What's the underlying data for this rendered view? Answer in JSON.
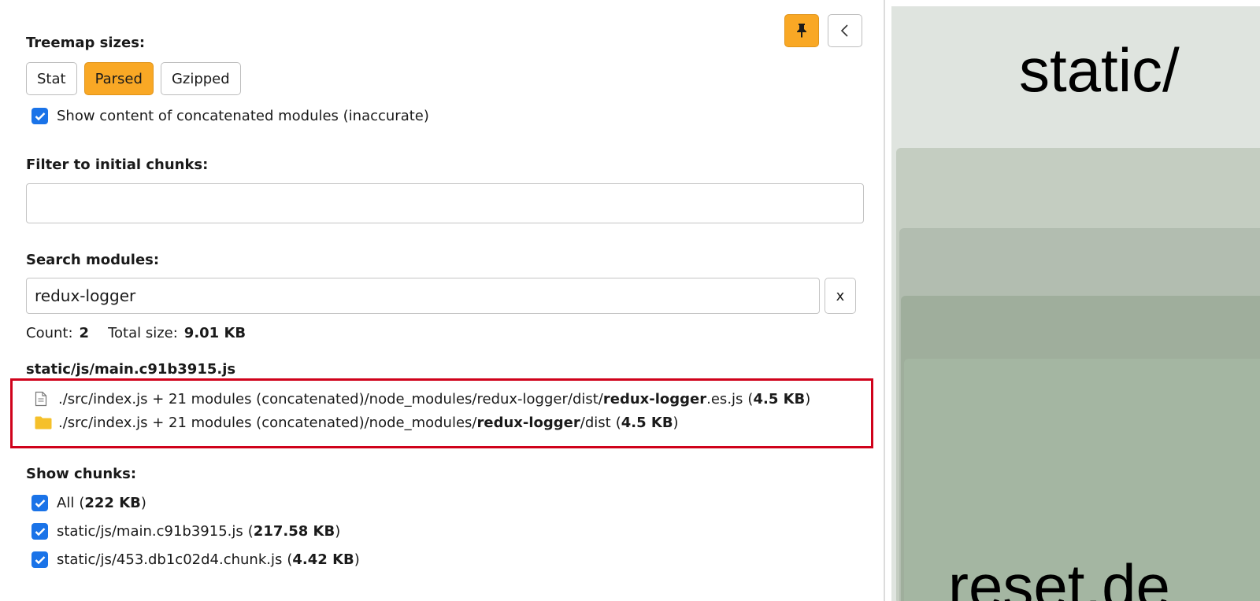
{
  "sidebar": {
    "treemap_sizes_label": "Treemap sizes:",
    "size_buttons": [
      "Stat",
      "Parsed",
      "Gzipped"
    ],
    "active_size": "Parsed",
    "concat_checkbox_label": "Show content of concatenated modules (inaccurate)",
    "filter_label": "Filter to initial chunks:",
    "filter_value": "",
    "search_label": "Search modules:",
    "search_value": "redux-logger",
    "clear_label": "x",
    "count_label": "Count:",
    "count_value": "2",
    "total_size_label": "Total size:",
    "total_size_value": "9.01 KB",
    "chunk_title": "static/js/main.c91b3915.js",
    "results": [
      {
        "icon": "file-icon",
        "prefix": "./src/index.js + 21 modules (concatenated)/node_modules/redux-logger/dist/",
        "match": "redux-logger",
        "suffix": ".es.js",
        "size": "4.5 KB"
      },
      {
        "icon": "folder-icon",
        "prefix": "./src/index.js + 21 modules (concatenated)/node_modules/",
        "match": "redux-logger",
        "suffix": "/dist",
        "size": "4.5 KB"
      }
    ],
    "show_chunks_label": "Show chunks:",
    "chunks": [
      {
        "name": "All",
        "size": "222 KB"
      },
      {
        "name": "static/js/main.c91b3915.js",
        "size": "217.58 KB"
      },
      {
        "name": "static/js/453.db1c02d4.chunk.js",
        "size": "4.42 KB"
      }
    ]
  },
  "treemap": {
    "top_label": "static/",
    "bottom_label": "reset.de"
  },
  "colors": {
    "accent": "#f9a825",
    "checkbox": "#1a73e8",
    "highlight_border": "#d0021b"
  }
}
